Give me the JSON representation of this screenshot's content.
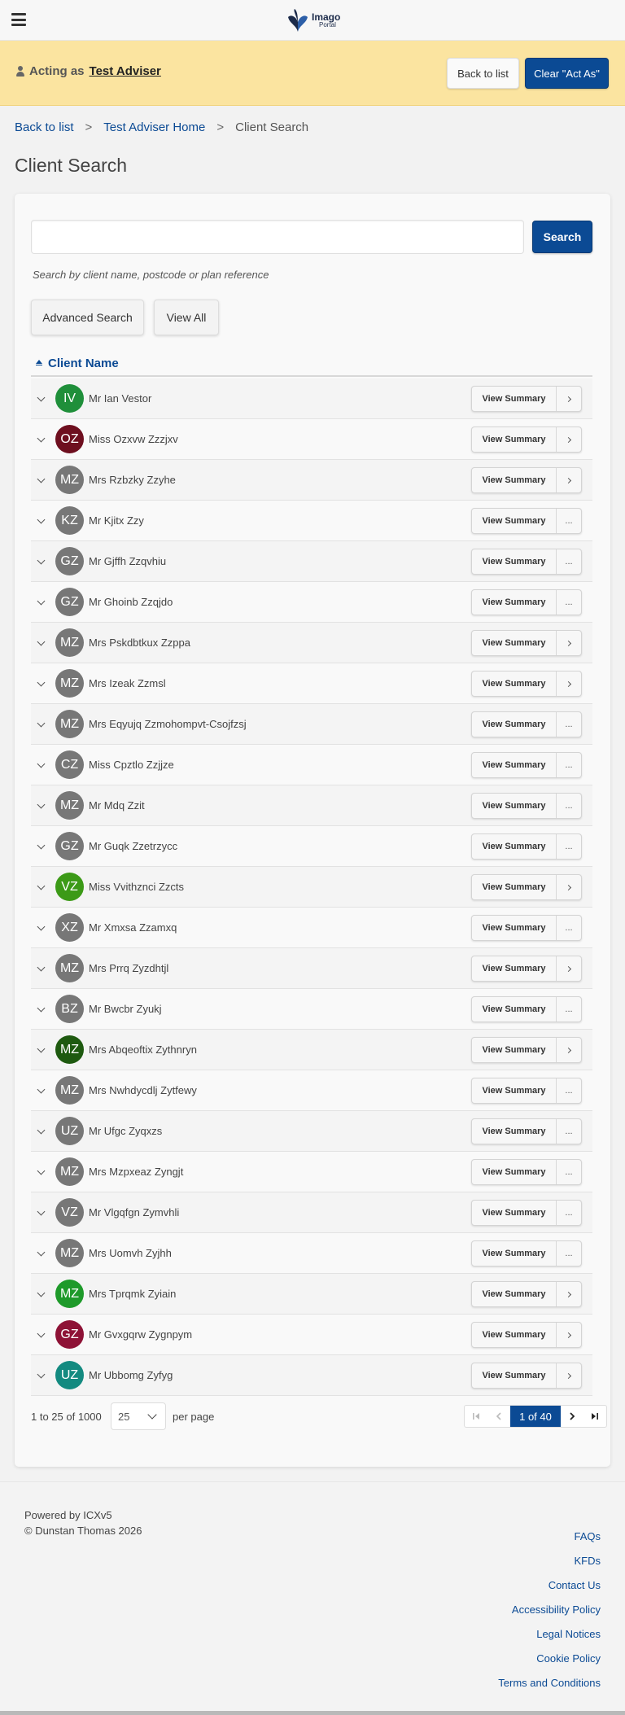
{
  "header": {
    "logo_title": "Imago",
    "logo_subtitle": "Portal"
  },
  "act_as": {
    "label": "Acting as",
    "adviser_name": "Test Adviser",
    "back_label": "Back to list",
    "clear_label": "Clear \"Act As\""
  },
  "breadcrumb": {
    "items": [
      "Back to list",
      "Test Adviser Home",
      "Client Search"
    ],
    "separator": ">"
  },
  "page_title": "Client Search",
  "search": {
    "value": "",
    "placeholder": "",
    "button_label": "Search",
    "hint": "Search by client name, postcode or plan reference",
    "advanced_label": "Advanced Search",
    "view_all_label": "View All"
  },
  "table": {
    "column_header": "Client Name",
    "view_summary_label": "View Summary",
    "more_label": "...",
    "rows": [
      {
        "initials": "IV",
        "name": "Mr Ian Vestor",
        "color": "#1f8f3a",
        "action": "arrow"
      },
      {
        "initials": "OZ",
        "name": "Miss Ozxvw Zzzjxv",
        "color": "#6e0f1f",
        "action": "arrow"
      },
      {
        "initials": "MZ",
        "name": "Mrs Rzbzky Zzyhe",
        "color": "#777777",
        "action": "arrow"
      },
      {
        "initials": "KZ",
        "name": "Mr Kjitx Zzy",
        "color": "#777777",
        "action": "more"
      },
      {
        "initials": "GZ",
        "name": "Mr Gjffh Zzqvhiu",
        "color": "#777777",
        "action": "more"
      },
      {
        "initials": "GZ",
        "name": "Mr Ghoinb Zzqjdo",
        "color": "#777777",
        "action": "more"
      },
      {
        "initials": "MZ",
        "name": "Mrs Pskdbtkux Zzppa",
        "color": "#777777",
        "action": "arrow"
      },
      {
        "initials": "MZ",
        "name": "Mrs Izeak Zzmsl",
        "color": "#777777",
        "action": "arrow"
      },
      {
        "initials": "MZ",
        "name": "Mrs Eqyujq Zzmohompvt-Csojfzsj",
        "color": "#777777",
        "action": "more"
      },
      {
        "initials": "CZ",
        "name": "Miss Cpztlo Zzjjze",
        "color": "#777777",
        "action": "more"
      },
      {
        "initials": "MZ",
        "name": "Mr Mdq Zzit",
        "color": "#777777",
        "action": "more"
      },
      {
        "initials": "GZ",
        "name": "Mr Guqk Zzetrzycc",
        "color": "#777777",
        "action": "more"
      },
      {
        "initials": "VZ",
        "name": "Miss Vvithznci Zzcts",
        "color": "#3c9a17",
        "action": "arrow"
      },
      {
        "initials": "XZ",
        "name": "Mr Xmxsa Zzamxq",
        "color": "#777777",
        "action": "more"
      },
      {
        "initials": "MZ",
        "name": "Mrs Prrq Zyzdhtjl",
        "color": "#777777",
        "action": "arrow"
      },
      {
        "initials": "BZ",
        "name": "Mr Bwcbr Zyukj",
        "color": "#777777",
        "action": "more"
      },
      {
        "initials": "MZ",
        "name": "Mrs Abqeoftix Zythnryn",
        "color": "#1e5a10",
        "action": "arrow"
      },
      {
        "initials": "MZ",
        "name": "Mrs Nwhdycdlj Zytfewy",
        "color": "#777777",
        "action": "more"
      },
      {
        "initials": "UZ",
        "name": "Mr Ufgc Zyqxzs",
        "color": "#777777",
        "action": "more"
      },
      {
        "initials": "MZ",
        "name": "Mrs Mzpxeaz Zyngjt",
        "color": "#777777",
        "action": "more"
      },
      {
        "initials": "VZ",
        "name": "Mr Vlgqfgn Zymvhli",
        "color": "#777777",
        "action": "more"
      },
      {
        "initials": "MZ",
        "name": "Mrs Uomvh Zyjhh",
        "color": "#777777",
        "action": "more"
      },
      {
        "initials": "MZ",
        "name": "Mrs Tprqmk Zyiain",
        "color": "#1e9a2a",
        "action": "arrow"
      },
      {
        "initials": "GZ",
        "name": "Mr Gvxgqrw Zygnpym",
        "color": "#8e1236",
        "action": "arrow"
      },
      {
        "initials": "UZ",
        "name": "Mr Ubbomg Zyfyg",
        "color": "#138a80",
        "action": "arrow"
      }
    ]
  },
  "pagination": {
    "range_text": "1 to 25 of 1000",
    "per_page_value": "25",
    "per_page_label": "per page",
    "page_text": "1 of 40"
  },
  "footer": {
    "powered_by": "Powered by ICXv5",
    "copyright": "© Dunstan Thomas 2026",
    "links": [
      "FAQs",
      "KFDs",
      "Contact Us",
      "Accessibility Policy",
      "Legal Notices",
      "Cookie Policy",
      "Terms and Conditions"
    ]
  },
  "colors": {
    "primary": "#0b4a94",
    "banner": "#fbe4a0"
  }
}
